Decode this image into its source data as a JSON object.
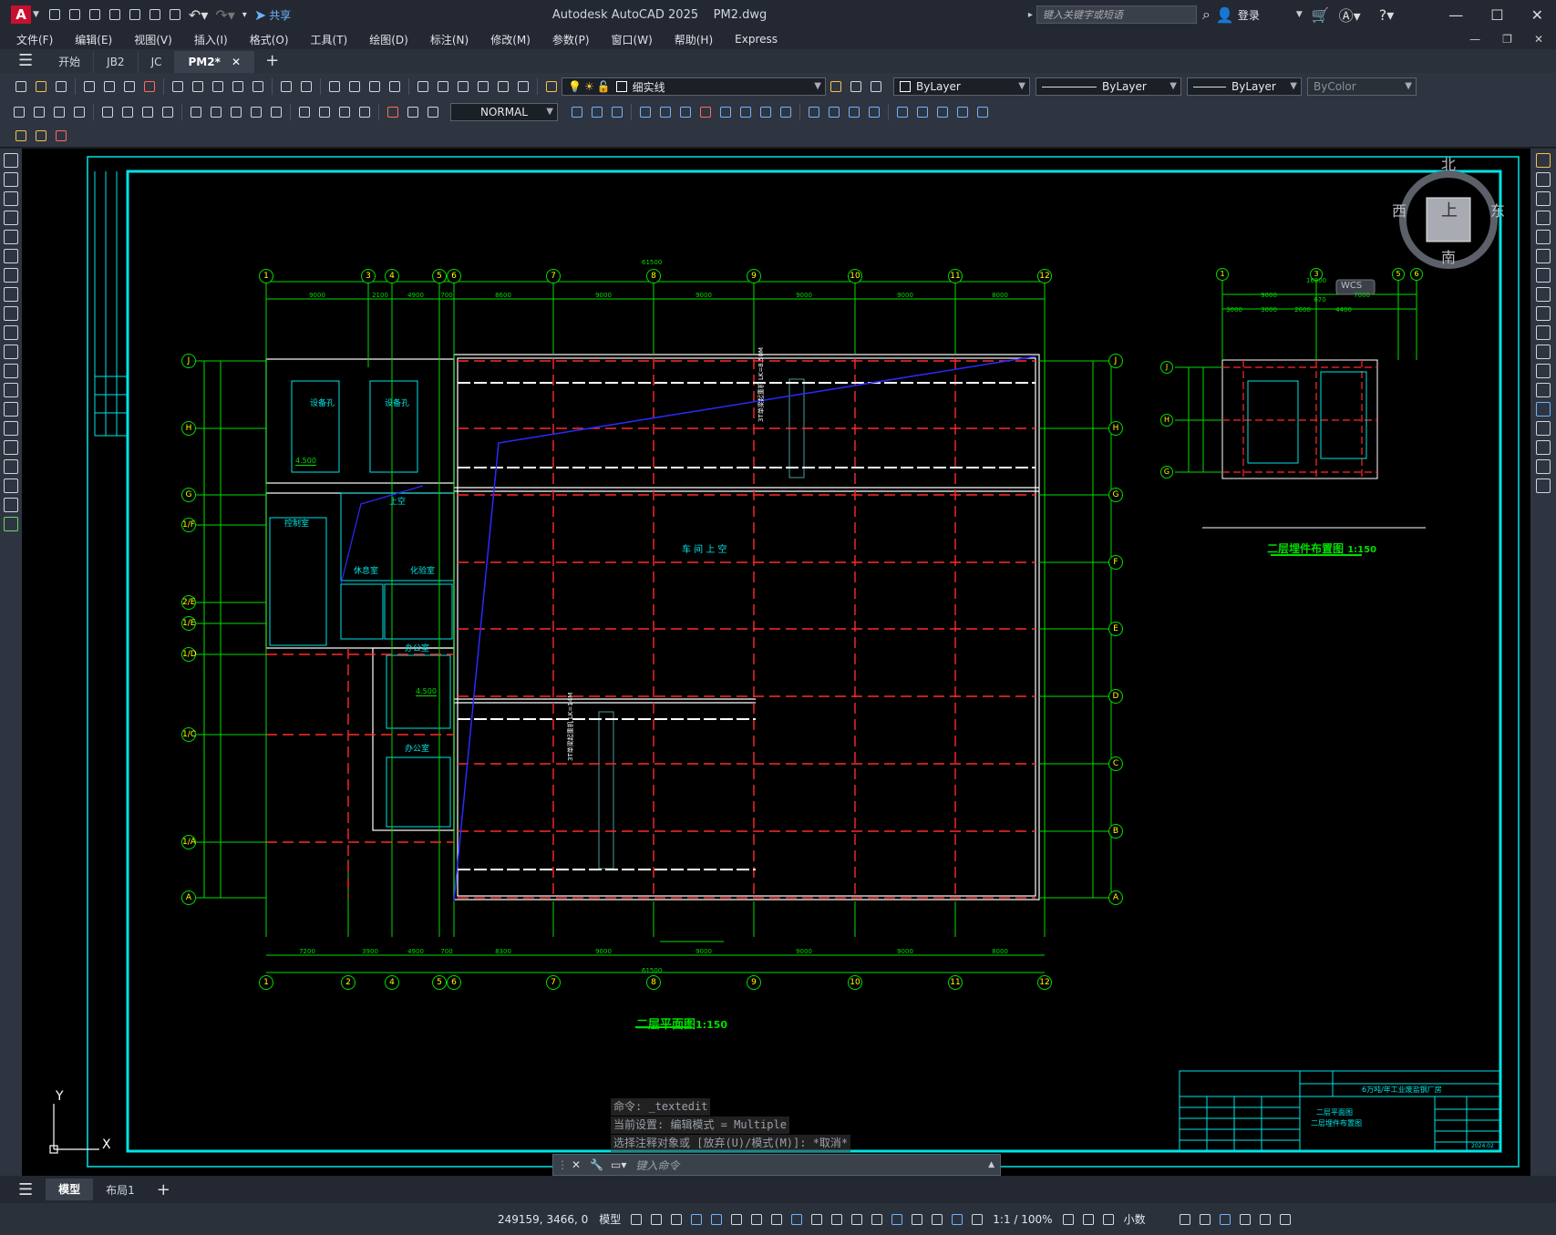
{
  "app": {
    "title": "Autodesk AutoCAD 2025",
    "file": "PM2.dwg",
    "share_label": "共享",
    "search_placeholder": "键入关键字或短语",
    "login_label": "登录"
  },
  "menu": [
    "文件(F)",
    "编辑(E)",
    "视图(V)",
    "插入(I)",
    "格式(O)",
    "工具(T)",
    "绘图(D)",
    "标注(N)",
    "修改(M)",
    "参数(P)",
    "窗口(W)",
    "帮助(H)",
    "Express"
  ],
  "tabs": [
    "开始",
    "JB2",
    "JC",
    "PM2*"
  ],
  "toolbar": {
    "layer_current": "细实线",
    "color": "ByLayer",
    "linetype": "ByLayer",
    "lineweight": "ByLayer",
    "plotstyle": "ByColor",
    "dimstyle": "NORMAL"
  },
  "viewcube": {
    "north": "北",
    "south": "南",
    "east": "东",
    "west": "西",
    "top": "上",
    "wcs": "WCS"
  },
  "ucs": {
    "x": "X",
    "y": "Y"
  },
  "drawing": {
    "main_title": "二层平面图",
    "main_scale": "1:150",
    "side_title": "二层埋件布置图",
    "side_scale": "1:150",
    "grid_top": [
      "1",
      "3",
      "4",
      "5",
      "6",
      "7",
      "8",
      "9",
      "10",
      "11",
      "12"
    ],
    "grid_bottom": [
      "1",
      "2",
      "4",
      "5",
      "6",
      "7",
      "8",
      "9",
      "10",
      "11",
      "12"
    ],
    "grid_rows": [
      "J",
      "H",
      "G",
      "1/F",
      "2/E",
      "1/E",
      "1/D",
      "1/C",
      "1/A",
      "A"
    ],
    "grid_rows_right": [
      "J",
      "H",
      "G",
      "F",
      "E",
      "D",
      "C",
      "B",
      "A"
    ],
    "dims_top": [
      "9000",
      "2100",
      "4900",
      "700",
      "8600",
      "9000",
      "9000",
      "9000",
      "9000",
      "8000"
    ],
    "dims_bottom": [
      "7200",
      "3900",
      "4900",
      "700",
      "8300",
      "9000",
      "9000",
      "9000",
      "9000",
      "8000"
    ],
    "total_top": "61500",
    "total_bottom": "61500",
    "rooms": {
      "equip1": "设备孔",
      "equip2": "设备孔",
      "control": "控制室",
      "upper": "上空",
      "rest": "休息室",
      "lab": "化验室",
      "office1": "办公室",
      "office2": "办公室",
      "workshop": "车 间 上 空"
    },
    "crane1": "3T单梁起重机 LK=8.50M",
    "crane2": "3T单梁起重机 LK=14M",
    "elev1": "4.500",
    "elev2": "4.500",
    "side_grid_top": [
      "1",
      "3",
      "5",
      "6"
    ],
    "side_grid_rows": [
      "J",
      "H",
      "G"
    ],
    "side_dims": [
      "16000",
      "9000",
      "7000",
      "670",
      "3000",
      "3000",
      "2600",
      "4400"
    ],
    "titleblock": {
      "project": "6万吨/年工业废盐钢厂房",
      "drawing_name_1": "二层平面图",
      "drawing_name_2": "二层埋件布置图",
      "date": "2024.02"
    }
  },
  "command": {
    "history": [
      "命令: _textedit",
      "当前设置: 编辑模式 = Multiple",
      "选择注释对象或 [放弃(U)/模式(M)]: *取消*"
    ],
    "placeholder": "键入命令"
  },
  "layouts": [
    "模型",
    "布局1"
  ],
  "status": {
    "coords": "249159, 3466, 0",
    "mode": "模型",
    "scale": "1:1 / 100%",
    "units": "小数"
  }
}
